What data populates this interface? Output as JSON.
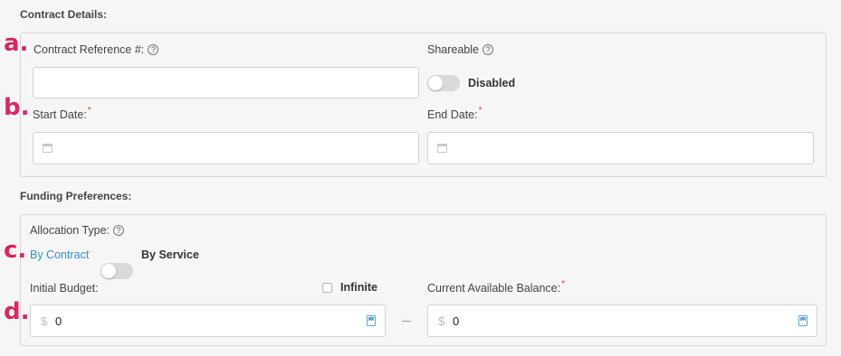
{
  "contract": {
    "section_title": "Contract Details:",
    "reference_label": "Contract Reference #:",
    "reference_value": "",
    "shareable_label": "Shareable",
    "shareable_state": "Disabled",
    "start_date_label": "Start Date:",
    "end_date_label": "End Date:",
    "required_mark": "*"
  },
  "funding": {
    "section_title": "Funding Preferences:",
    "allocation_label": "Allocation Type:",
    "by_contract": "By Contract",
    "by_service": "By Service",
    "initial_budget_label": "Initial Budget:",
    "infinite_label": "Infinite",
    "currency_symbol": "$",
    "initial_budget_value": "0",
    "current_balance_label": "Current Available Balance:",
    "current_balance_value": "0"
  },
  "annotations": [
    "a.",
    "b.",
    "c.",
    "d."
  ],
  "help_glyph": "?",
  "colors": {
    "accent": "#2f8fd8",
    "required": "#e53935",
    "marker": "#e0245e"
  }
}
